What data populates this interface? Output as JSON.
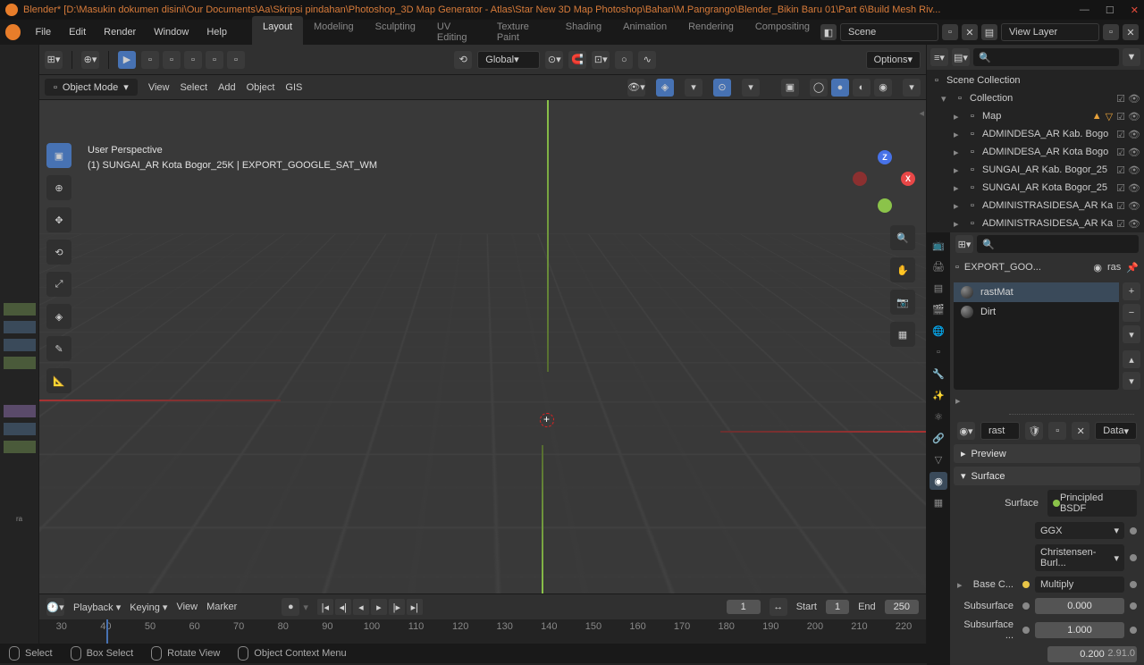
{
  "titlebar": {
    "app": "Blender*",
    "path": "[D:\\Masukin dokumen disini\\Our Documents\\Aa\\Skripsi pindahan\\Photoshop_3D Map Generator - Atlas\\Star New 3D Map Photoshop\\Bahan\\M.Pangrango\\Blender_Bikin Baru 01\\Part 6\\Build Mesh Riv..."
  },
  "topmenu": [
    "File",
    "Edit",
    "Render",
    "Window",
    "Help"
  ],
  "workspaces": [
    "Layout",
    "Modeling",
    "Sculpting",
    "UV Editing",
    "Texture Paint",
    "Shading",
    "Animation",
    "Rendering",
    "Compositing"
  ],
  "scene": {
    "label": "Scene",
    "viewlayer": "View Layer"
  },
  "vp_header": {
    "orientation": "Global",
    "options": "Options"
  },
  "vp_sub": {
    "mode": "Object Mode",
    "menus": [
      "View",
      "Select",
      "Add",
      "Object",
      "GIS"
    ]
  },
  "vp_info": {
    "line1": "User Perspective",
    "line2": "(1) SUNGAI_AR Kota Bogor_25K | EXPORT_GOOGLE_SAT_WM"
  },
  "gizmo": {
    "x": "X",
    "y": "",
    "z": "Z"
  },
  "timeline": {
    "menus": [
      "Playback",
      "Keying",
      "View",
      "Marker"
    ],
    "current": "1",
    "start_label": "Start",
    "start": "1",
    "end_label": "End",
    "end": "250",
    "frames": [
      "30",
      "40",
      "50",
      "60",
      "70",
      "80",
      "90",
      "100",
      "110",
      "120",
      "130",
      "140",
      "150",
      "160",
      "170",
      "180",
      "190",
      "200",
      "210",
      "220"
    ]
  },
  "statusbar": {
    "items": [
      "Select",
      "Box Select",
      "Rotate View",
      "Object Context Menu"
    ],
    "version": "2.91.0"
  },
  "outliner": {
    "root": "Scene Collection",
    "items": [
      {
        "label": "Collection",
        "indent": 1,
        "arrow": "▾"
      },
      {
        "label": "Map",
        "indent": 2,
        "arrow": "▸",
        "extra": true
      },
      {
        "label": "ADMINDESA_AR Kab. Bogo",
        "indent": 2,
        "arrow": "▸"
      },
      {
        "label": "ADMINDESA_AR Kota Bogo",
        "indent": 2,
        "arrow": "▸"
      },
      {
        "label": "SUNGAI_AR Kab. Bogor_25",
        "indent": 2,
        "arrow": "▸"
      },
      {
        "label": "SUNGAI_AR Kota Bogor_25",
        "indent": 2,
        "arrow": "▸"
      },
      {
        "label": "ADMINISTRASIDESA_AR Ka",
        "indent": 2,
        "arrow": "▸"
      },
      {
        "label": "ADMINISTRASIDESA_AR Ka",
        "indent": 2,
        "arrow": "▸"
      }
    ]
  },
  "properties": {
    "crumb_obj": "EXPORT_GOO...",
    "crumb_mat": "ras",
    "materials": [
      {
        "name": "rastMat",
        "active": true
      },
      {
        "name": "Dirt",
        "active": false
      }
    ],
    "mat_name": "rast",
    "data_btn": "Data",
    "panels": {
      "preview": "Preview",
      "surface": "Surface"
    },
    "surface": {
      "label": "Surface",
      "value": "Principled BSDF",
      "dist": "GGX",
      "sss_method": "Christensen-Burl...",
      "basecolor_label": "Base C...",
      "basecolor_mode": "Multiply",
      "subsurface_label": "Subsurface",
      "subsurface": "0.000",
      "subsurface_r_label": "Subsurface ...",
      "subsurface_r": "1.000",
      "subsurface_r2": "0.200"
    }
  },
  "leftpanel_label": "ra"
}
